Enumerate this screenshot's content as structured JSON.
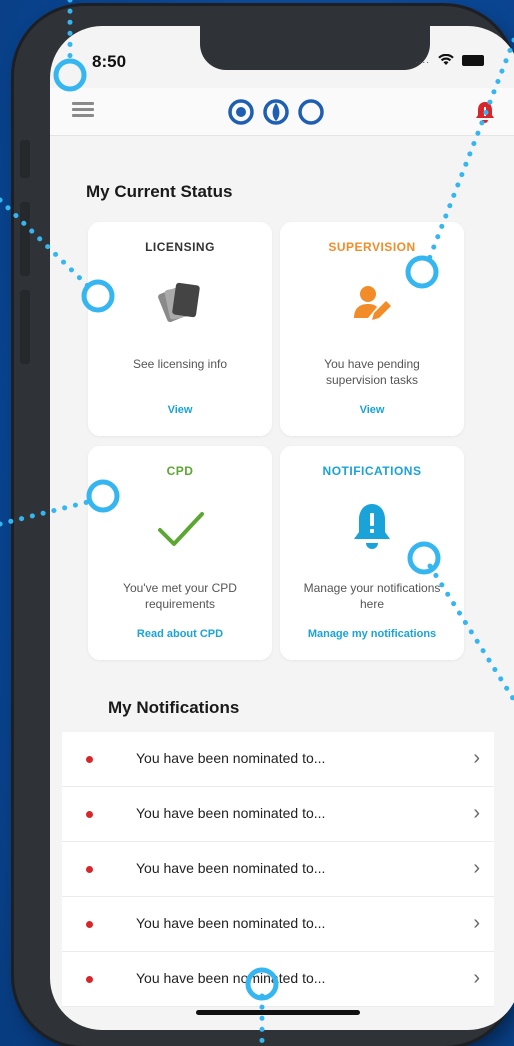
{
  "status_bar": {
    "time": "8:50",
    "signal": "....",
    "icons": [
      "wifi-icon",
      "battery-icon"
    ]
  },
  "navbar": {
    "menu_icon": "hamburger-icon",
    "logo_icon": "brand-logo",
    "alert_icon": "bell-alert-icon"
  },
  "status_section": {
    "title": "My Current Status"
  },
  "cards": [
    {
      "title": "LICENSING",
      "title_color": "#333333",
      "icon": "license-cards-icon",
      "desc": "See licensing info",
      "link": "View"
    },
    {
      "title": "SUPERVISION",
      "title_color": "#f28c28",
      "icon": "person-edit-icon",
      "desc": "You have pending supervision tasks",
      "link": "View"
    },
    {
      "title": "CPD",
      "title_color": "#5ba731",
      "icon": "checkmark-icon",
      "desc": "You've met your CPD requirements",
      "link": "Read about CPD"
    },
    {
      "title": "NOTIFICATIONS",
      "title_color": "#1aa3d9",
      "icon": "bell-icon",
      "desc": "Manage your notifications here",
      "link": "Manage my notifications"
    }
  ],
  "notifications_section": {
    "title": "My Notifications"
  },
  "notifications": [
    {
      "text": "You have been nominated to..."
    },
    {
      "text": "You have been nominated to..."
    },
    {
      "text": "You have been nominated to..."
    },
    {
      "text": "You have been nominated to..."
    },
    {
      "text": "You have been nominated to..."
    }
  ],
  "colors": {
    "accent_blue": "#1aa3d9",
    "brand_navy": "#1e5fb4",
    "alert_red": "#d9262b",
    "background_blue": "#0d4fa0",
    "hotspot": "#36b6f0"
  }
}
